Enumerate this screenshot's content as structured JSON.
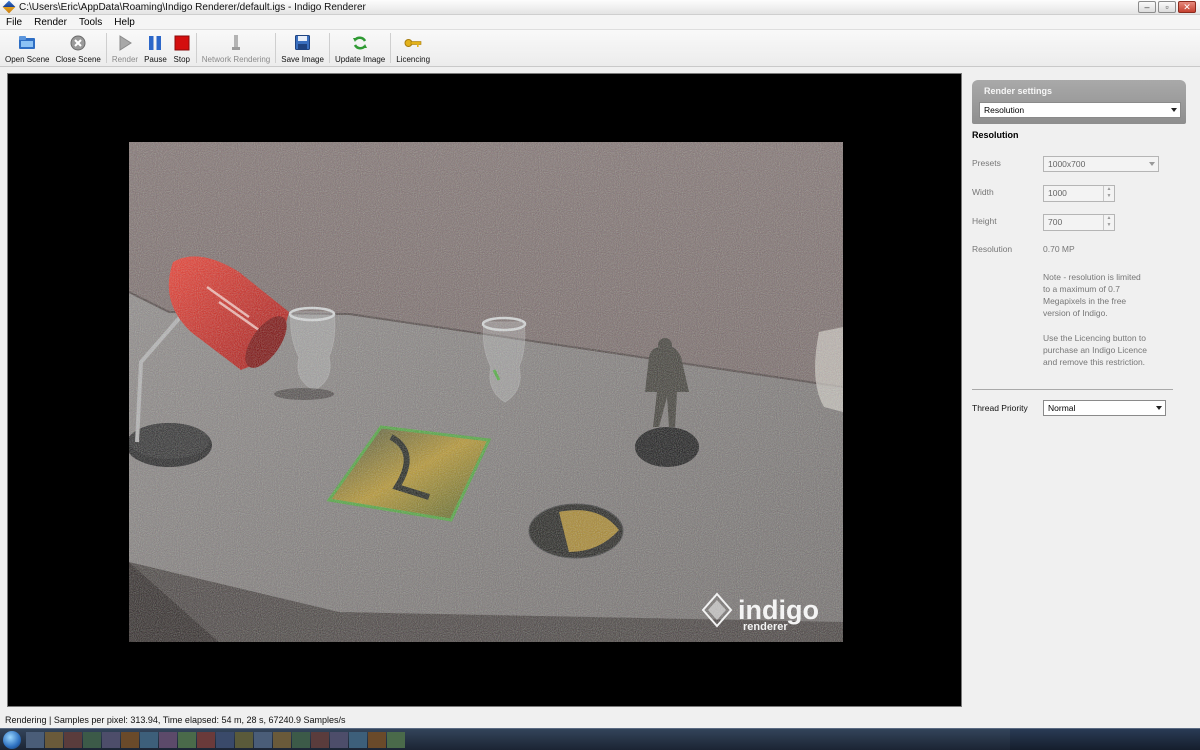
{
  "window": {
    "title": "C:\\Users\\Eric\\AppData\\Roaming\\Indigo Renderer/default.igs - Indigo Renderer",
    "minimize": "–",
    "maximize": "▫",
    "close": "✕"
  },
  "menu": {
    "items": [
      "File",
      "Render",
      "Tools",
      "Help"
    ]
  },
  "toolbar": {
    "open_scene": "Open Scene",
    "close_scene": "Close Scene",
    "render": "Render",
    "pause": "Pause",
    "stop": "Stop",
    "network_rendering": "Network Rendering",
    "save_image": "Save Image",
    "update_image": "Update Image",
    "licencing": "Licencing"
  },
  "render": {
    "logo_main": "indigo",
    "logo_sub": "renderer"
  },
  "panel": {
    "header_title": "Render settings",
    "category_select": "Resolution",
    "section_title": "Resolution",
    "presets_label": "Presets",
    "presets_value": "1000x700",
    "width_label": "Width",
    "width_value": "1000",
    "height_label": "Height",
    "height_value": "700",
    "resolution_label": "Resolution",
    "resolution_value": "0.70 MP",
    "note_lines": [
      "Note - resolution is limited",
      "to a maximum of 0.7",
      "Megapixels in the free",
      "version of Indigo."
    ],
    "licence_lines": [
      "Use the Licencing button to",
      "purchase an Indigo Licence",
      "and remove this restriction."
    ],
    "thread_priority_label": "Thread Priority",
    "thread_priority_value": "Normal"
  },
  "status": {
    "text": "Rendering | Samples per pixel: 313.94, Time elapsed: 54 m, 28 s, 67240.9 Samples/s"
  },
  "colors": {
    "lamp_red": "#d51a16",
    "stop_red": "#d40f0f",
    "panel_header": "#9b9b9b"
  }
}
